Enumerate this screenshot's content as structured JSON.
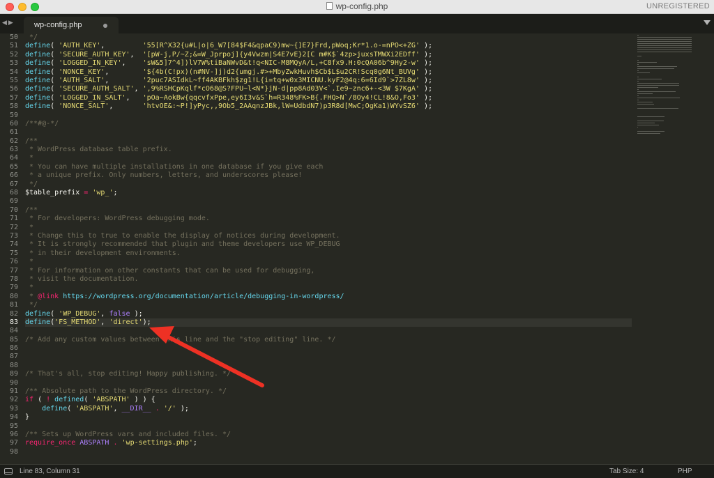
{
  "window": {
    "title": "wp-config.php",
    "registration": "UNREGISTERED"
  },
  "tab": {
    "label": "wp-config.php"
  },
  "editor": {
    "current_line": 83,
    "lines": [
      {
        "n": "50",
        "parts": [
          [
            "c-com",
            " */"
          ]
        ]
      },
      {
        "n": "51",
        "parts": [
          [
            "c-fn",
            "define"
          ],
          [
            "c-pl",
            "( "
          ],
          [
            "c-str",
            "'AUTH_KEY'"
          ],
          [
            "c-pl",
            ",         "
          ],
          [
            "c-str",
            "'55[R^X32{u#L|o|6_W7[84$F4&qpaC9)mw~{]E7}Frd,pWoq;Kr*1.o-=nPO<+ZG'"
          ],
          [
            "c-pl",
            " );"
          ]
        ]
      },
      {
        "n": "52",
        "parts": [
          [
            "c-fn",
            "define"
          ],
          [
            "c-pl",
            "( "
          ],
          [
            "c-str",
            "'SECURE_AUTH_KEY'"
          ],
          [
            "c-pl",
            ",  "
          ],
          [
            "c-str",
            "'[pW-j,P/~Z;&=W_Jprpoj]{y4Vwzm|S4E7vE}2[C m#K$`4zp>juxsTMWXi2EDff'"
          ],
          [
            "c-pl",
            " );"
          ]
        ]
      },
      {
        "n": "53",
        "parts": [
          [
            "c-fn",
            "define"
          ],
          [
            "c-pl",
            "( "
          ],
          [
            "c-str",
            "'LOGGED_IN_KEY'"
          ],
          [
            "c-pl",
            ",    "
          ],
          [
            "c-str",
            "'sW&5]7^4])lV7W%tiBaNWvD&t!q<NIC-M8MQyA/L,+C8fx9.H:0cQA06b^9Hy2-w'"
          ],
          [
            "c-pl",
            " );"
          ]
        ]
      },
      {
        "n": "54",
        "parts": [
          [
            "c-fn",
            "define"
          ],
          [
            "c-pl",
            "( "
          ],
          [
            "c-str",
            "'NONCE_KEY'"
          ],
          [
            "c-pl",
            ",        "
          ],
          [
            "c-str",
            "'${4b(C!px)(n#NV-]j)d2{umgj.#>+MbyZwkHuvh$Cb$L$u2CR!Scq0g6Nt_BUVg'"
          ],
          [
            "c-pl",
            " );"
          ]
        ]
      },
      {
        "n": "55",
        "parts": [
          [
            "c-fn",
            "define"
          ],
          [
            "c-pl",
            "( "
          ],
          [
            "c-str",
            "'AUTH_SALT'"
          ],
          [
            "c-pl",
            ",        "
          ],
          [
            "c-str",
            "'2puc7ASIdkL~ff4AKBFkh$zg1!L{i=tq+w0x3MICNU.kyF2@4q:6=6Id9`>7ZL8w'"
          ],
          [
            "c-pl",
            " );"
          ]
        ]
      },
      {
        "n": "56",
        "parts": [
          [
            "c-fn",
            "define"
          ],
          [
            "c-pl",
            "( "
          ],
          [
            "c-str",
            "'SECURE_AUTH_SALT'"
          ],
          [
            "c-pl",
            ", "
          ],
          [
            "c-str",
            "',9%RSHCpKqlf*cO68@S?FPU~l<N*}jN-d|pp8Ad03V<`.Ie9~znc6+-<3W $7KgA'"
          ],
          [
            "c-pl",
            " );"
          ]
        ]
      },
      {
        "n": "57",
        "parts": [
          [
            "c-fn",
            "define"
          ],
          [
            "c-pl",
            "( "
          ],
          [
            "c-str",
            "'LOGGED_IN_SALT'"
          ],
          [
            "c-pl",
            ",   "
          ],
          [
            "c-str",
            "'pOa~AokBw{qqcvfxPpe,ey6I3v&S`h=R348%FK>B{.FHQ>N`/8Oy4!CL!8&O,Fo3'"
          ],
          [
            "c-pl",
            " );"
          ]
        ]
      },
      {
        "n": "58",
        "parts": [
          [
            "c-fn",
            "define"
          ],
          [
            "c-pl",
            "( "
          ],
          [
            "c-str",
            "'NONCE_SALT'"
          ],
          [
            "c-pl",
            ",       "
          ],
          [
            "c-str",
            "'htvOE&:~P!]yPyc,,9Ob5_2AAqnzJBk,lW=UdbdN7)p3R8d[MwC;OgKa1)WYvSZ6'"
          ],
          [
            "c-pl",
            " );"
          ]
        ]
      },
      {
        "n": "59",
        "parts": []
      },
      {
        "n": "60",
        "parts": [
          [
            "c-com",
            "/**#@-*/"
          ]
        ]
      },
      {
        "n": "61",
        "parts": []
      },
      {
        "n": "62",
        "parts": [
          [
            "c-com",
            "/**"
          ]
        ]
      },
      {
        "n": "63",
        "parts": [
          [
            "c-com",
            " * WordPress database table prefix."
          ]
        ]
      },
      {
        "n": "64",
        "parts": [
          [
            "c-com",
            " *"
          ]
        ]
      },
      {
        "n": "65",
        "parts": [
          [
            "c-com",
            " * You can have multiple installations in one database if you give each"
          ]
        ]
      },
      {
        "n": "66",
        "parts": [
          [
            "c-com",
            " * a unique prefix. Only numbers, letters, and underscores please!"
          ]
        ]
      },
      {
        "n": "67",
        "parts": [
          [
            "c-com",
            " */"
          ]
        ]
      },
      {
        "n": "68",
        "parts": [
          [
            "c-pl",
            "$table_prefix "
          ],
          [
            "c-kw",
            "="
          ],
          [
            "c-pl",
            " "
          ],
          [
            "c-str",
            "'wp_'"
          ],
          [
            "c-pl",
            ";"
          ]
        ]
      },
      {
        "n": "69",
        "parts": []
      },
      {
        "n": "70",
        "parts": [
          [
            "c-com",
            "/**"
          ]
        ]
      },
      {
        "n": "71",
        "parts": [
          [
            "c-com",
            " * For developers: WordPress debugging mode."
          ]
        ]
      },
      {
        "n": "72",
        "parts": [
          [
            "c-com",
            " *"
          ]
        ]
      },
      {
        "n": "73",
        "parts": [
          [
            "c-com",
            " * Change this to true to enable the display of notices during development."
          ]
        ]
      },
      {
        "n": "74",
        "parts": [
          [
            "c-com",
            " * It is strongly recommended that plugin and theme developers use WP_DEBUG"
          ]
        ]
      },
      {
        "n": "75",
        "parts": [
          [
            "c-com",
            " * in their development environments."
          ]
        ]
      },
      {
        "n": "76",
        "parts": [
          [
            "c-com",
            " *"
          ]
        ]
      },
      {
        "n": "77",
        "parts": [
          [
            "c-com",
            " * For information on other constants that can be used for debugging,"
          ]
        ]
      },
      {
        "n": "78",
        "parts": [
          [
            "c-com",
            " * visit the documentation."
          ]
        ]
      },
      {
        "n": "79",
        "parts": [
          [
            "c-com",
            " *"
          ]
        ]
      },
      {
        "n": "80",
        "parts": [
          [
            "c-com",
            " * "
          ],
          [
            "c-kw",
            "@link"
          ],
          [
            "c-pl",
            " "
          ],
          [
            "c-fn",
            "https://wordpress.org/documentation/article/debugging-in-wordpress/"
          ]
        ]
      },
      {
        "n": "81",
        "parts": [
          [
            "c-com",
            " */"
          ]
        ]
      },
      {
        "n": "82",
        "parts": [
          [
            "c-fn",
            "define"
          ],
          [
            "c-pl",
            "( "
          ],
          [
            "c-str",
            "'WP_DEBUG'"
          ],
          [
            "c-pl",
            ", "
          ],
          [
            "c-pur",
            "false"
          ],
          [
            "c-pl",
            " );"
          ]
        ]
      },
      {
        "n": "83",
        "parts": [
          [
            "c-fn",
            "define"
          ],
          [
            "c-pl",
            "("
          ],
          [
            "c-str",
            "'FS_METHOD'"
          ],
          [
            "c-pl",
            ", "
          ],
          [
            "c-str",
            "'direct'"
          ],
          [
            "c-pl",
            ");"
          ]
        ]
      },
      {
        "n": "84",
        "parts": []
      },
      {
        "n": "85",
        "parts": [
          [
            "c-com",
            "/* Add any custom values between this line and the \"stop editing\" line. */"
          ]
        ]
      },
      {
        "n": "86",
        "parts": []
      },
      {
        "n": "87",
        "parts": []
      },
      {
        "n": "88",
        "parts": []
      },
      {
        "n": "89",
        "parts": [
          [
            "c-com",
            "/* That's all, stop editing! Happy publishing. */"
          ]
        ]
      },
      {
        "n": "90",
        "parts": []
      },
      {
        "n": "91",
        "parts": [
          [
            "c-com",
            "/** Absolute path to the WordPress directory. */"
          ]
        ]
      },
      {
        "n": "92",
        "parts": [
          [
            "c-kw",
            "if"
          ],
          [
            "c-pl",
            " ( "
          ],
          [
            "c-kw",
            "!"
          ],
          [
            "c-pl",
            " "
          ],
          [
            "c-fn",
            "defined"
          ],
          [
            "c-pl",
            "( "
          ],
          [
            "c-str",
            "'ABSPATH'"
          ],
          [
            "c-pl",
            " ) ) {"
          ]
        ]
      },
      {
        "n": "93",
        "parts": [
          [
            "c-pl",
            "    "
          ],
          [
            "c-fn",
            "define"
          ],
          [
            "c-pl",
            "( "
          ],
          [
            "c-str",
            "'ABSPATH'"
          ],
          [
            "c-pl",
            ", "
          ],
          [
            "c-pur",
            "__DIR__"
          ],
          [
            "c-pl",
            " "
          ],
          [
            "c-kw",
            "."
          ],
          [
            "c-pl",
            " "
          ],
          [
            "c-str",
            "'/'"
          ],
          [
            "c-pl",
            " );"
          ]
        ]
      },
      {
        "n": "94",
        "parts": [
          [
            "c-pl",
            "}"
          ]
        ]
      },
      {
        "n": "95",
        "parts": []
      },
      {
        "n": "96",
        "parts": [
          [
            "c-com",
            "/** Sets up WordPress vars and included files. */"
          ]
        ]
      },
      {
        "n": "97",
        "parts": [
          [
            "c-kw",
            "require_once"
          ],
          [
            "c-pl",
            " "
          ],
          [
            "c-pur",
            "ABSPATH"
          ],
          [
            "c-pl",
            " "
          ],
          [
            "c-kw",
            "."
          ],
          [
            "c-pl",
            " "
          ],
          [
            "c-str",
            "'wp-settings.php'"
          ],
          [
            "c-pl",
            ";"
          ]
        ]
      },
      {
        "n": "98",
        "parts": []
      }
    ]
  },
  "status": {
    "position": "Line 83, Column 31",
    "tab_size": "Tab Size: 4",
    "syntax": "PHP"
  },
  "colors": {
    "background": "#272822",
    "comment": "#75715e",
    "function": "#66d9ef",
    "string": "#e6db74",
    "keyword": "#f92672",
    "constant": "#ae81ff",
    "annotation_arrow": "#ee3124"
  },
  "icons": {
    "close": "close-window-icon",
    "minimize": "minimize-window-icon",
    "maximize": "maximize-window-icon",
    "file": "file-icon",
    "tab_dirty": "unsaved-dot-icon",
    "tab_menu": "chevron-down-icon",
    "nav": "tab-nav-arrows-icon",
    "panel": "panel-toggle-icon",
    "annotation": "red-arrow-annotation"
  }
}
